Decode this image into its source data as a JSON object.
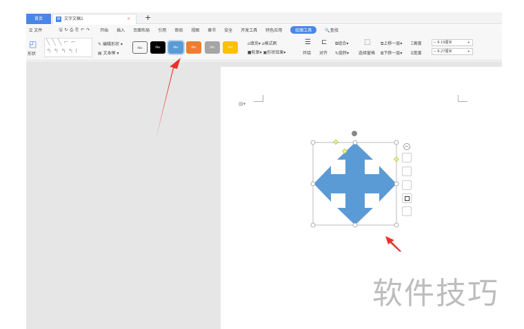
{
  "tabs": {
    "home": "首页",
    "doc": "文字文稿1",
    "close": "×",
    "new": "+"
  },
  "menu": {
    "file": "文件",
    "items": [
      "开始",
      "插入",
      "页面布局",
      "引用",
      "审阅",
      "视图",
      "章节",
      "安全",
      "开发工具",
      "特色应用"
    ],
    "active": "绘图工具",
    "search": "查找"
  },
  "ribbon": {
    "shape": "形状",
    "edit_shape": "编辑形状",
    "textbox": "文本框",
    "style_label": "Abc",
    "fill": "填充",
    "format_painter": "格式刷",
    "outline": "轮廓",
    "shape_effect": "形状效果",
    "wrap": "环绕",
    "align": "对齐",
    "group": "组合",
    "rotate": "旋转",
    "selection_pane": "选择窗格",
    "bring_forward": "上移一层",
    "send_backward": "下移一层",
    "height_label": "高度",
    "width_label": "宽度",
    "height_value": "6.19厘米",
    "width_value": "6.27厘米"
  },
  "styles": [
    {
      "bg": "#ffffff",
      "fg": "#333"
    },
    {
      "bg": "#000000",
      "fg": "#fff"
    },
    {
      "bg": "#5b9bd5",
      "fg": "#fff"
    },
    {
      "bg": "#ed7d31",
      "fg": "#fff"
    },
    {
      "bg": "#a5a5a5",
      "fg": "#fff"
    },
    {
      "bg": "#ffc000",
      "fg": "#fff"
    }
  ],
  "shape_color": "#5b9bd5",
  "watermark": "软件技巧"
}
